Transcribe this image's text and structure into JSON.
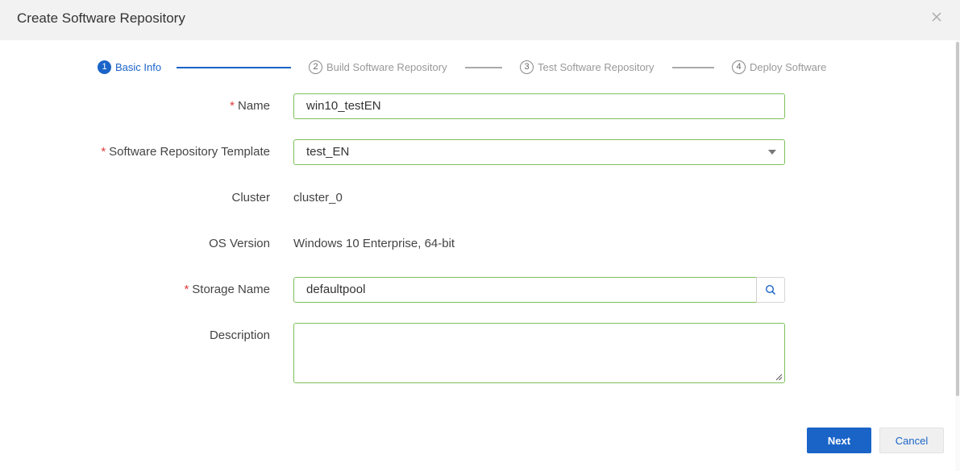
{
  "dialog": {
    "title": "Create Software Repository"
  },
  "steps": [
    {
      "num": "1",
      "label": "Basic Info",
      "active": true
    },
    {
      "num": "2",
      "label": "Build Software Repository",
      "active": false
    },
    {
      "num": "3",
      "label": "Test Software Repository",
      "active": false
    },
    {
      "num": "4",
      "label": "Deploy Software",
      "active": false
    }
  ],
  "form": {
    "name_label": "Name",
    "name_value": "win10_testEN",
    "template_label": "Software Repository Template",
    "template_value": "test_EN",
    "cluster_label": "Cluster",
    "cluster_value": "cluster_0",
    "os_label": "OS Version",
    "os_value": "Windows 10 Enterprise, 64-bit",
    "storage_label": "Storage Name",
    "storage_value": "defaultpool",
    "description_label": "Description",
    "description_value": "",
    "required_mark": "*"
  },
  "buttons": {
    "next": "Next",
    "cancel": "Cancel"
  },
  "colors": {
    "accent": "#1a64c8",
    "valid_border": "#7ec05a",
    "required": "#e03a3a"
  },
  "icons": {
    "close": "close-icon",
    "search": "search-icon",
    "dropdown": "chevron-down-icon"
  }
}
